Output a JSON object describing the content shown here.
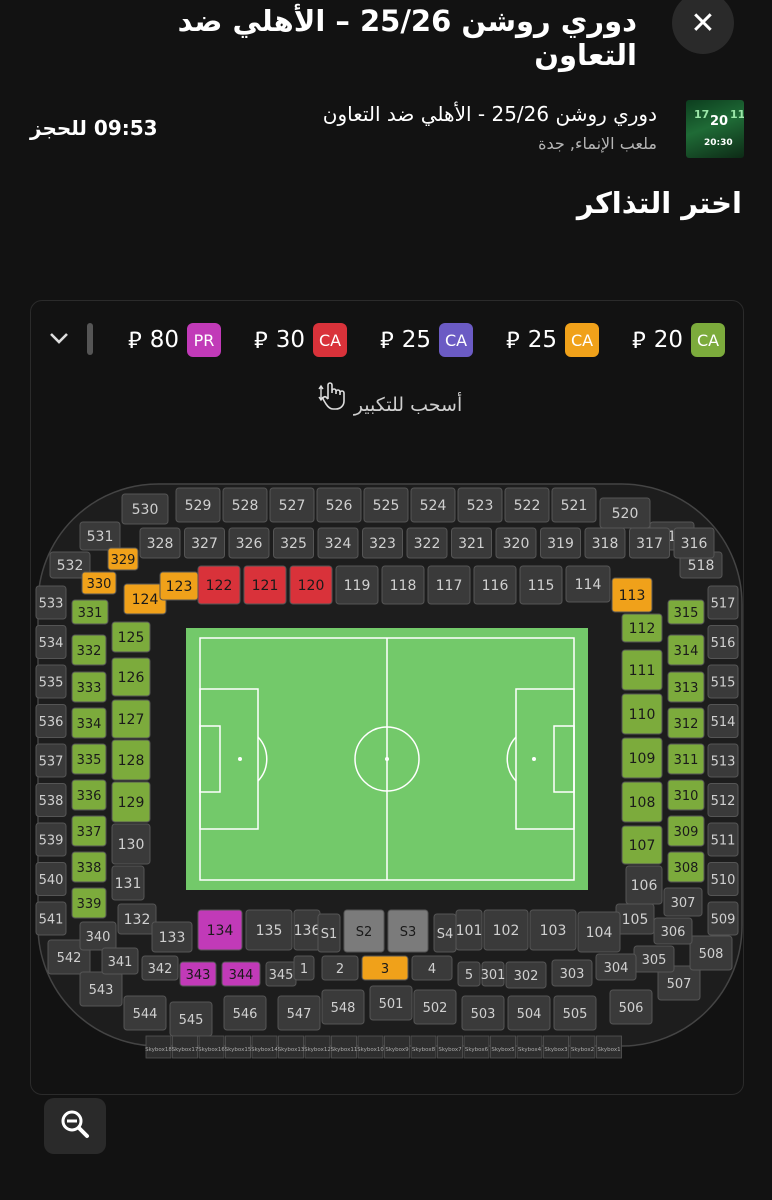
{
  "header": {
    "title": "دوري روشن 25/26 – الأهلي ضد التعاون",
    "close_symbol": "✕"
  },
  "event": {
    "name": "دوري روشن 25/26 - الأهلي ضد التعاون",
    "venue": "ملعب الإنماء, جدة",
    "thumb_text": "20:30",
    "timer": "09:53 للحجز"
  },
  "section_title": "اختر التذاكر",
  "currency_symbol": "⃁",
  "legend": [
    {
      "code": "CA",
      "price": "20",
      "color": "#7cab3c"
    },
    {
      "code": "CA",
      "price": "25",
      "color": "#f0a11a"
    },
    {
      "code": "CA",
      "price": "25",
      "color": "#6b5bc4"
    },
    {
      "code": "CA",
      "price": "30",
      "color": "#d9323a"
    },
    {
      "code": "PR",
      "price": "80",
      "color": "#c13ab8"
    }
  ],
  "hint": "أسحب للتكبير",
  "colors": {
    "green": "#7cab3c",
    "orange": "#f0a11a",
    "red": "#d9323a",
    "purple": "#c13ab8",
    "grey": "#3a3a3a",
    "pitch": "#73c96a"
  },
  "sections": {
    "upper_top": [
      "529",
      "528",
      "527",
      "526",
      "525",
      "524",
      "523",
      "522",
      "521"
    ],
    "upper_corner_tl": [
      "530",
      "531",
      "532"
    ],
    "upper_corner_tr": [
      "520",
      "519",
      "518"
    ],
    "upper_left": [
      "533",
      "534",
      "535",
      "536",
      "537",
      "538",
      "539",
      "540",
      "541"
    ],
    "upper_right": [
      "517",
      "516",
      "515",
      "514",
      "513",
      "512",
      "511",
      "510",
      "509"
    ],
    "upper_bottom": [
      "542",
      "543",
      "544",
      "545",
      "546",
      "547",
      "548",
      "501",
      "502",
      "503",
      "504",
      "505",
      "506",
      "507",
      "508"
    ],
    "mid_top": [
      "328",
      "327",
      "326",
      "325",
      "324",
      "323",
      "322",
      "321",
      "320",
      "319",
      "318",
      "317",
      "316"
    ],
    "mid_left": [
      "329",
      "330",
      "331",
      "332",
      "333",
      "334",
      "335",
      "336",
      "337",
      "338",
      "339",
      "340",
      "341",
      "342",
      "343",
      "344",
      "345"
    ],
    "mid_right": [
      "315",
      "314",
      "313",
      "312",
      "311",
      "310",
      "309",
      "308",
      "307",
      "306",
      "305",
      "304",
      "303",
      "302",
      "301"
    ],
    "lower_top": [
      "124",
      "123",
      "122",
      "121",
      "120",
      "119",
      "118",
      "117",
      "116",
      "115",
      "114",
      "113"
    ],
    "lower_left": [
      "125",
      "126",
      "127",
      "128",
      "129",
      "130",
      "131",
      "132",
      "133",
      "134",
      "135",
      "136"
    ],
    "lower_right": [
      "112",
      "111",
      "110",
      "109",
      "108",
      "107",
      "106",
      "105",
      "104",
      "103",
      "102",
      "101"
    ],
    "special": [
      "S1",
      "S2",
      "S3",
      "S4",
      "1",
      "2",
      "3",
      "4",
      "5"
    ],
    "skyboxes": [
      "Skybox18",
      "Skybox17",
      "Skybox16",
      "Skybox15",
      "Skybox14",
      "Skybox13",
      "Skybox12",
      "Skybox11",
      "Skybox10",
      "Skybox9",
      "Skybox8",
      "Skybox7",
      "Skybox6",
      "Skybox5",
      "Skybox4",
      "Skybox3",
      "Skybox2",
      "Skybox1"
    ]
  }
}
